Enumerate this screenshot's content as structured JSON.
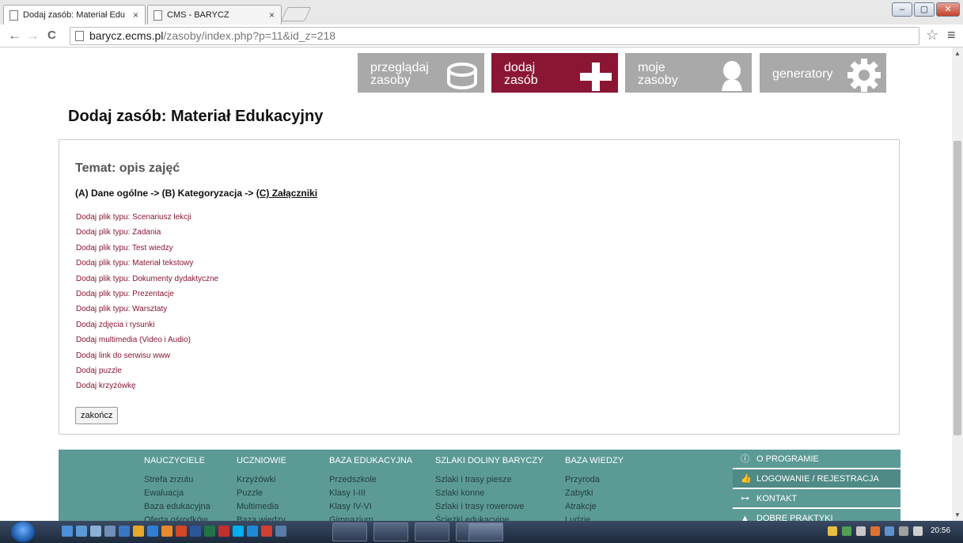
{
  "browser": {
    "tabs": [
      {
        "label": "Dodaj zasób: Materiał Edu"
      },
      {
        "label": "CMS - BARYCZ"
      }
    ],
    "url_domain": "barycz.ecms.pl",
    "url_path": "/zasoby/index.php?p=11&id_z=218"
  },
  "nav": {
    "items": [
      {
        "line1": "przeglądaj",
        "line2": "zasoby",
        "icon": "database-icon"
      },
      {
        "line1": "dodaj",
        "line2": "zasób",
        "icon": "plus-icon"
      },
      {
        "line1": "moje",
        "line2": "zasoby",
        "icon": "user-icon"
      },
      {
        "line1": "generatory",
        "line2": "",
        "icon": "gear-icon"
      }
    ]
  },
  "page_title": "Dodaj zasób: Materiał Edukacyjny",
  "content": {
    "topic": "Temat: opis zajęć",
    "steps": {
      "a": "(A) Dane ogólne -> (B) Kategoryzacja -> ",
      "c": "(C) Załączniki"
    },
    "links": [
      "Dodaj plik typu: Scenariusz lekcji",
      "Dodaj plik typu: Zadania",
      "Dodaj plik typu: Test wiedzy",
      "Dodaj plik typu: Materiał tekstowy",
      "Dodaj plik typu: Dokumenty dydaktyczne",
      "Dodaj plik typu: Prezentacje",
      "Dodaj plik typu: Warsztaty",
      "Dodaj zdjęcia i rysunki",
      "Dodaj multimedia (Video i Audio)",
      "Dodaj link do serwisu www",
      "Dodaj puzzle",
      "Dodaj krzyżówkę"
    ],
    "finish_label": "zakończ"
  },
  "footer": {
    "columns": [
      {
        "head": "NAUCZYCIELE",
        "items": [
          "Strefa zrzutu",
          "Ewaluacja",
          "Baza edukacyjna",
          "Oferta ośrodków"
        ]
      },
      {
        "head": "UCZNIOWIE",
        "items": [
          "Krzyżówki",
          "Puzzle",
          "Multimedia",
          "Baza wiedzy"
        ]
      },
      {
        "head": "BAZA EDUKACYJNA",
        "items": [
          "Przedszkole",
          "Klasy I-III",
          "Klasy IV-VI",
          "Gimnazjum"
        ]
      },
      {
        "head": "SZLAKI DOLINY BARYCZY",
        "items": [
          "Szlaki i trasy piesze",
          "Szlaki konne",
          "Szlaki i trasy rowerowe",
          "Ścieżki edukacyjne"
        ]
      },
      {
        "head": "BAZA WIEDZY",
        "items": [
          "Przyroda",
          "Zabytki",
          "Atrakcje",
          "Ludzie"
        ]
      }
    ],
    "side_buttons": [
      {
        "label": "O PROGRAMIE",
        "icon": "info-icon"
      },
      {
        "label": "LOGOWANIE / REJESTRACJA",
        "icon": "thumbs-up-icon"
      },
      {
        "label": "KONTAKT",
        "icon": "key-icon"
      },
      {
        "label": "DOBRE PRAKTYKI",
        "icon": "pin-icon"
      }
    ]
  },
  "taskbar": {
    "clock": "20:56"
  },
  "colors": {
    "accent": "#8b1633",
    "footer": "#5c9a96",
    "tile_grey": "#a9a9a9"
  }
}
